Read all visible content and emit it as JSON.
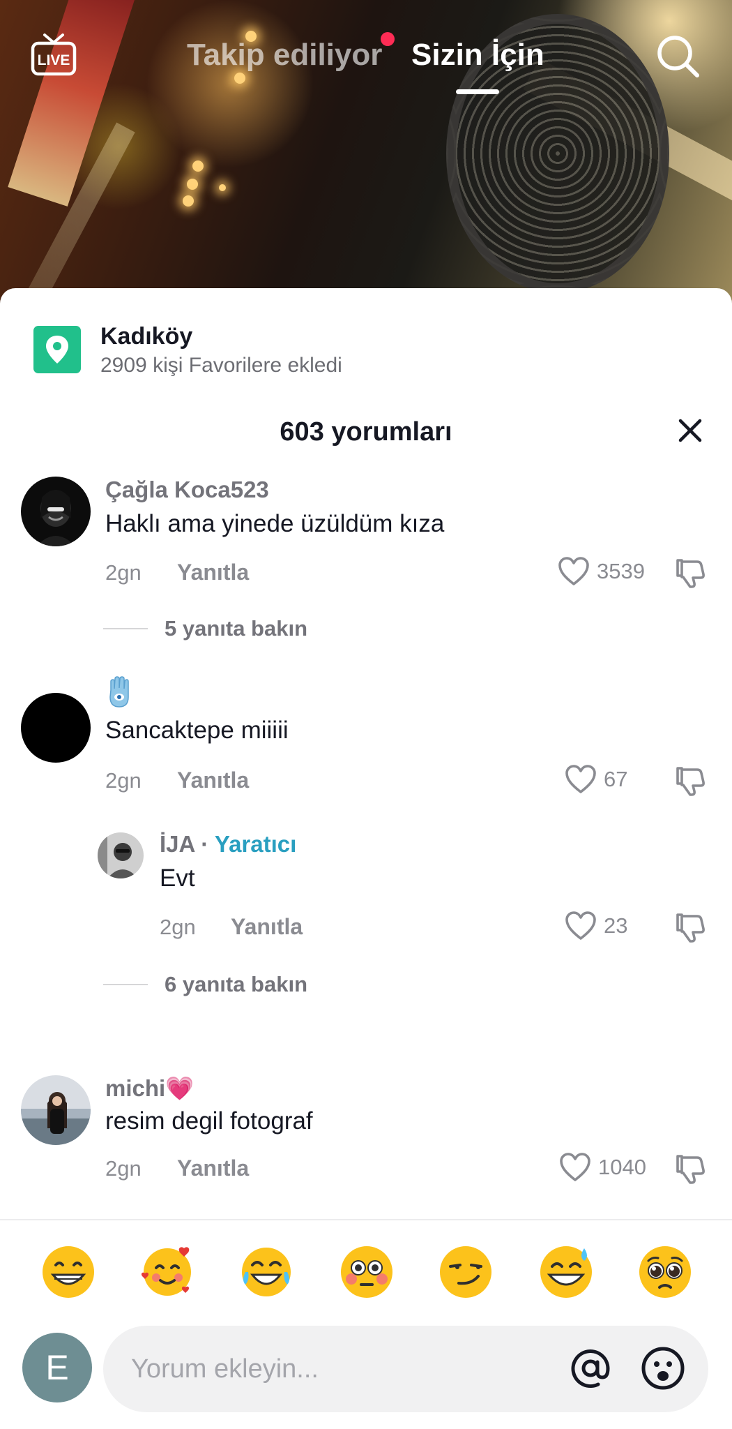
{
  "top_nav": {
    "live_label": "LIVE",
    "tabs": [
      {
        "label": "Takip ediliyor",
        "has_notification": true
      },
      {
        "label": "Sizin İçin",
        "active": true
      }
    ]
  },
  "location": {
    "title": "Kadıköy",
    "subtitle": "2909 kişi Favorilere ekledi"
  },
  "comments_header": {
    "title": "603 yorumları"
  },
  "comments": [
    {
      "username": "Çağla Koca523",
      "text": "Haklı ama yinede üzüldüm kıza",
      "time": "2gn",
      "reply_label": "Yanıtla",
      "likes": "3539",
      "view_replies": "5 yanıta bakın"
    },
    {
      "username": "",
      "text": "Sancaktepe miiiii",
      "time": "2gn",
      "reply_label": "Yanıtla",
      "likes": "67",
      "reply": {
        "username": "İJA",
        "separator": " · ",
        "creator_label": "Yaratıcı",
        "text": "Evt",
        "time": "2gn",
        "reply_label": "Yanıtla",
        "likes": "23"
      },
      "view_replies": "6 yanıta bakın"
    },
    {
      "username": "michi💗",
      "text": "resim degil fotograf",
      "time": "2gn",
      "reply_label": "Yanıtla",
      "likes": "1040"
    }
  ],
  "emoji_bar": [
    "grinning-face",
    "smiling-face-with-hearts",
    "tears-of-joy",
    "flushed-face",
    "smirking-face",
    "sweat-smile",
    "pleading-face"
  ],
  "composer": {
    "avatar_initial": "E",
    "placeholder": "Yorum ekleyin..."
  },
  "colors": {
    "accent_red": "#fe2c55",
    "location_green": "#21c08b",
    "creator_blue": "#2a9fc0"
  }
}
